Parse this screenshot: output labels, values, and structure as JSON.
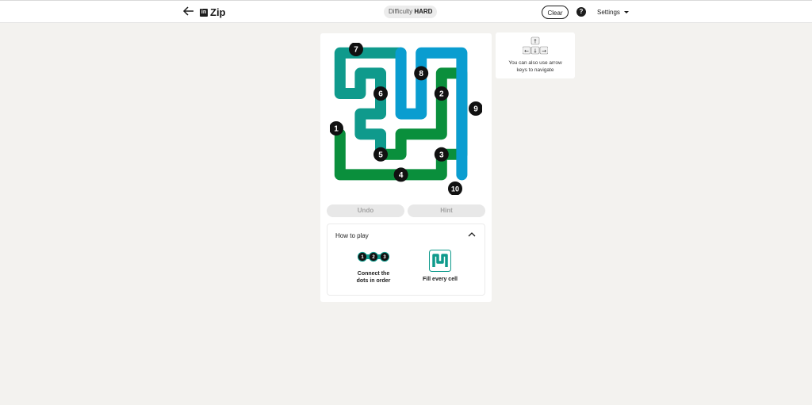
{
  "header": {
    "title": "Zip",
    "logo": "in",
    "difficulty_label": "Difficulty",
    "difficulty_value": "HARD",
    "clear_label": "Clear",
    "help_label": "?",
    "settings_label": "Settings",
    "back_icon": "arrow-left-icon",
    "settings_icon": "caret-down-icon"
  },
  "board": {
    "rows": 7,
    "cols": 7,
    "dots": [
      "1",
      "2",
      "3",
      "4",
      "5",
      "6",
      "7",
      "8",
      "9",
      "10"
    ],
    "colors": {
      "start": "#0a8f3c",
      "mid": "#0f9a8c",
      "end": "#0a9dd0",
      "dot": "#111111",
      "board_bg": "#ffffff"
    }
  },
  "controls": {
    "undo_label": "Undo",
    "hint_label": "Hint"
  },
  "how_to_play": {
    "title": "How to play",
    "tip1_line1": "Connect the",
    "tip1_line2": "dots in order",
    "tip1_dots": [
      "1",
      "2",
      "3"
    ],
    "tip2": "Fill every cell",
    "collapse_icon": "chevron-up-icon"
  },
  "side_tip": {
    "text_line1": "You can also use arrow",
    "text_line2": "keys to navigate",
    "keys": [
      "↑",
      "←",
      "↓",
      "→"
    ]
  }
}
